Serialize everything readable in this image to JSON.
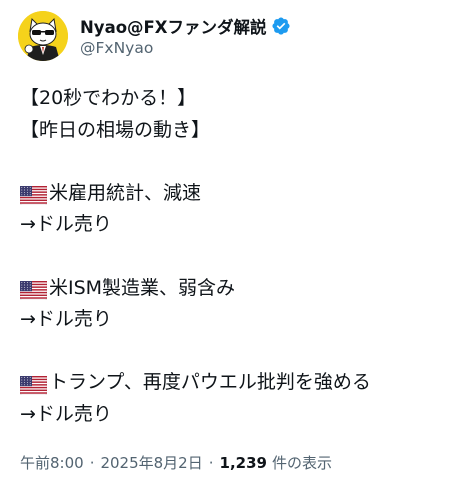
{
  "author": {
    "display_name": "Nyao@FXファンダ解説",
    "handle": "@FxNyao",
    "verified_icon": "verified-badge-icon",
    "avatar_icon": "cat-with-sunglasses-avatar"
  },
  "post": {
    "lines": [
      {
        "text": "【20秒でわかる！】",
        "flag": false
      },
      {
        "text": "【昨日の相場の動き】",
        "flag": false
      },
      {
        "text": "",
        "flag": false
      },
      {
        "text": "米雇用統計、減速",
        "flag": true
      },
      {
        "text": "→ドル売り",
        "flag": false
      },
      {
        "text": "",
        "flag": false
      },
      {
        "text": "米ISM製造業、弱含み",
        "flag": true
      },
      {
        "text": "→ドル売り",
        "flag": false
      },
      {
        "text": "",
        "flag": false
      },
      {
        "text": "トランプ、再度パウエル批判を強める",
        "flag": true
      },
      {
        "text": "→ドル売り",
        "flag": false
      }
    ],
    "flag_icon": "us-flag-icon"
  },
  "meta": {
    "time": "午前8:00",
    "separator": "·",
    "date": "2025年8月2日",
    "views_count": "1,239",
    "views_label": "件の表示"
  },
  "colors": {
    "text_primary": "#0f1419",
    "text_secondary": "#536471",
    "verified_blue": "#1d9bf0",
    "avatar_yellow": "#f5d21b"
  }
}
